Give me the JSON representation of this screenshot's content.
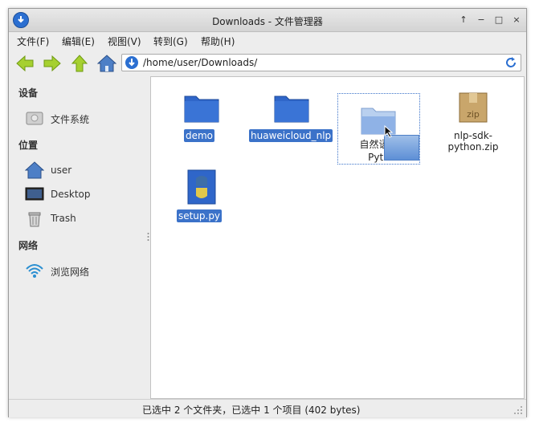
{
  "window": {
    "title": "Downloads - 文件管理器"
  },
  "window_buttons": [
    "↑",
    "−",
    "□",
    "×"
  ],
  "menu": [
    "文件(F)",
    "编辑(E)",
    "视图(V)",
    "转到(G)",
    "帮助(H)"
  ],
  "toolbar": {
    "back_icon": "arrow-left-icon",
    "forward_icon": "arrow-right-icon",
    "up_icon": "arrow-up-icon",
    "home_icon": "home-icon",
    "location_value": "/home/user/Downloads/",
    "reload_icon": "reload-icon"
  },
  "sidebar": {
    "devices_header": "设备",
    "devices": [
      {
        "label": "文件系统",
        "icon": "drive-icon"
      }
    ],
    "places_header": "位置",
    "places": [
      {
        "label": "user",
        "icon": "home-icon"
      },
      {
        "label": "Desktop",
        "icon": "desktop-icon"
      },
      {
        "label": "Trash",
        "icon": "trash-icon"
      }
    ],
    "network_header": "网络",
    "network": [
      {
        "label": "浏览网络",
        "icon": "network-icon"
      }
    ]
  },
  "files": [
    {
      "name": "demo",
      "type": "folder",
      "selected": true
    },
    {
      "name": "huaweicloud_nlp",
      "type": "folder",
      "selected": true
    },
    {
      "name": "自然语言处理Python",
      "name_visible_line1": "自然语言",
      "name_visible_line2": "Pyth",
      "type": "folder",
      "selected": false,
      "focused": true
    },
    {
      "name": "nlp-sdk-python.zip",
      "type": "zip",
      "icon_label": "zip",
      "selected": false
    },
    {
      "name": "setup.py",
      "type": "python",
      "selected": true
    }
  ],
  "status": {
    "text": "已选中 2 个文件夹，已选中 1 个项目 (402 bytes)"
  },
  "colors": {
    "selection": "#3b72c9",
    "folder": "#2f66c9",
    "accent": "#2b6fd1"
  }
}
